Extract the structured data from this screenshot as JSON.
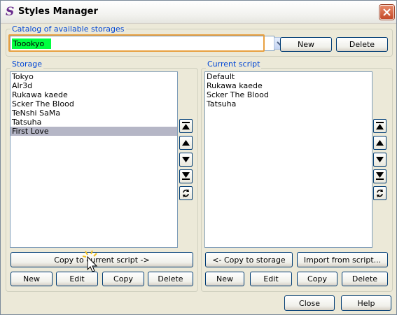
{
  "window": {
    "title": "Styles Manager",
    "icon": "styles-icon"
  },
  "catalog": {
    "label": "Catalog of available storages",
    "selected": "Toookyo",
    "new_label": "New",
    "delete_label": "Delete"
  },
  "storage": {
    "label": "Storage",
    "items": [
      "Tokyo",
      "Alr3d",
      "Rukawa kaede",
      "Scker The Blood",
      "TeNshi SaMa",
      "Tatsuha",
      "First Love"
    ],
    "selected_index": 6,
    "copy_label": "Copy to current script ->",
    "new_label": "New",
    "edit_label": "Edit",
    "copy_btn_label": "Copy",
    "delete_label": "Delete"
  },
  "script": {
    "label": "Current script",
    "items": [
      "Default",
      "Rukawa kaede",
      "Scker The Blood",
      "Tatsuha"
    ],
    "copy_label": "<- Copy to storage",
    "import_label": "Import from script...",
    "new_label": "New",
    "edit_label": "Edit",
    "copy_btn_label": "Copy",
    "delete_label": "Delete"
  },
  "footer": {
    "close_label": "Close",
    "help_label": "Help"
  },
  "colors": {
    "group_label": "#0046d5",
    "selection": "#b5b6c6",
    "combo_highlight": "#00ff40",
    "focus_ring": "#e8a040"
  }
}
